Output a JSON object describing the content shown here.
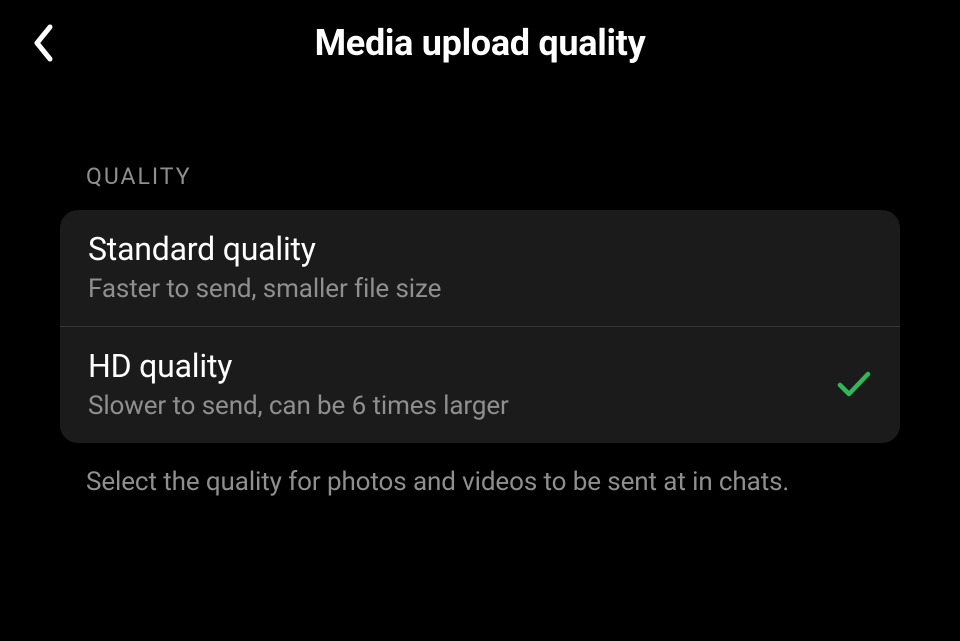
{
  "header": {
    "title": "Media upload quality"
  },
  "section": {
    "header": "QUALITY",
    "options": [
      {
        "title": "Standard quality",
        "subtitle": "Faster to send, smaller file size",
        "selected": false
      },
      {
        "title": "HD quality",
        "subtitle": "Slower to send, can be 6 times larger",
        "selected": true
      }
    ],
    "footer": "Select the quality for photos and videos to be sent at in chats."
  },
  "colors": {
    "accent_check": "#31B85A"
  }
}
